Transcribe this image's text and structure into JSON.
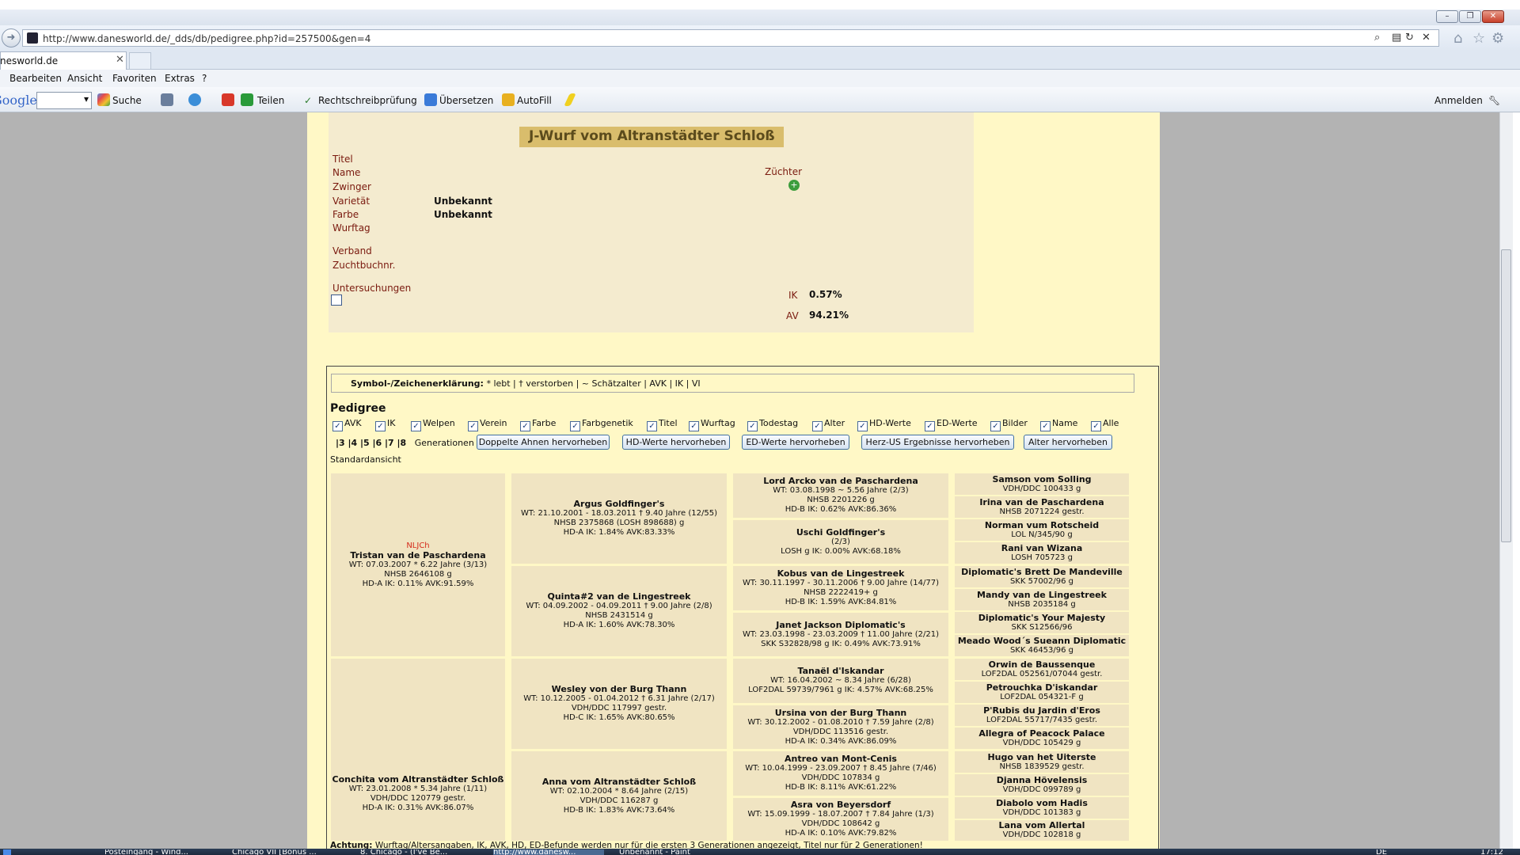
{
  "browser": {
    "url": "http://www.danesworld.de/_dds/db/pedigree.php?id=257500&gen=4",
    "tab_title": "nesworld.de",
    "menu": [
      "Bearbeiten",
      "Ansicht",
      "Favoriten",
      "Extras",
      "?"
    ],
    "toolbar": {
      "google": "Google",
      "suche": "Suche",
      "teilen": "Teilen",
      "spell": "Rechtschreibprüfung",
      "translate": "Übersetzen",
      "autofill": "AutoFill",
      "anmelden": "Anmelden"
    }
  },
  "litter": {
    "heading": "J-Wurf vom Altranstädter Schloß",
    "labels": {
      "titel": "Titel",
      "name": "Name",
      "zwinger": "Zwinger",
      "varietat": "Varietät",
      "farbe": "Farbe",
      "wurftag": "Wurftag",
      "verband": "Verband",
      "zuchtbuch": "Zuchtbuchnr.",
      "untersuchungen": "Untersuchungen",
      "zuchter": "Züchter",
      "ik": "IK",
      "av": "AV"
    },
    "values": {
      "varietat": "Unbekannt",
      "farbe": "Unbekannt",
      "ik": "0.57%",
      "av": "94.21%"
    }
  },
  "pedigree": {
    "legend_label": "Symbol-/Zeichenerklärung:",
    "legend_text": " * lebt | † verstorben | ~ Schätzalter | AVK | IK | VI",
    "title": "Pedigree",
    "checkboxes": [
      "AVK",
      "IK",
      "Welpen",
      "Verein",
      "Farbe",
      "Farbgenetik",
      "Titel",
      "Wurftag",
      "Todestag",
      "Alter",
      "HD-Werte",
      "ED-Werte",
      "Bilder",
      "Name",
      "Alle"
    ],
    "generations": "|3 |4 |5 |6 |7 |8",
    "generations_label": "Generationen",
    "buttons": [
      "Doppelte Ahnen hervorheben",
      "HD-Werte hervorheben",
      "ED-Werte hervorheben",
      "Herz-US Ergebnisse hervorheben",
      "Alter hervorheben"
    ],
    "standard_view": "Standardansicht",
    "note_label": "Achtung:",
    "note_text": " Wurftag/Altersangaben, IK, AVK, HD, ED-Befunde werden nur für die ersten 3 Generationen angezeigt, Titel nur für 2 Generationen!",
    "gen1": [
      {
        "title": "NLJCh",
        "name": "Tristan van de Paschardena",
        "l1": "WT: 07.03.2007 * 6.22 Jahre (3/13)",
        "l2": "NHSB 2646108   g",
        "l3": "HD-A   IK: 0.11%   AVK:91.59%"
      },
      {
        "title": "",
        "name": "Conchita vom Altranstädter Schloß",
        "l1": "WT: 23.01.2008 * 5.34 Jahre (1/11)",
        "l2": "VDH/DDC 120779   gestr.",
        "l3": "HD-A   IK: 0.31%   AVK:86.07%"
      }
    ],
    "gen2": [
      {
        "name": "Argus Goldfinger's",
        "l1": "WT: 21.10.2001 - 18.03.2011 † 9.40 Jahre (12/55)",
        "l2": "NHSB 2375868 (LOSH 898688)   g",
        "l3": "HD-A   IK: 1.84%   AVK:83.33%"
      },
      {
        "name": "Quinta#2 van de Lingestreek",
        "l1": "WT: 04.09.2002 - 04.09.2011 † 9.00 Jahre (2/8)",
        "l2": "NHSB 2431514   g",
        "l3": "HD-A   IK: 1.60%   AVK:78.30%"
      },
      {
        "name": "Wesley von der Burg Thann",
        "l1": "WT: 10.12.2005 - 01.04.2012 † 6.31 Jahre (2/17)",
        "l2": "VDH/DDC 117997   gestr.",
        "l3": "HD-C   IK: 1.65%   AVK:80.65%"
      },
      {
        "name": "Anna vom Altranstädter Schloß",
        "l1": "WT: 02.10.2004 * 8.64 Jahre (2/15)",
        "l2": "VDH/DDC 116287   g",
        "l3": "HD-B   IK: 1.83%   AVK:73.64%"
      }
    ],
    "gen3": [
      {
        "name": "Lord Arcko van de Paschardena",
        "l1": "WT: 03.08.1998 ~ 5.56 Jahre (2/3)",
        "l2": "NHSB 2201226   g",
        "l3": "HD-B   IK: 0.62%   AVK:86.36%"
      },
      {
        "name": "Uschi Goldfinger's",
        "l1": "(2/3)",
        "l2": "",
        "l3": "LOSH   g   IK: 0.00%   AVK:68.18%"
      },
      {
        "name": "Kobus van de Lingestreek",
        "l1": "WT: 30.11.1997 - 30.11.2006 † 9.00 Jahre (14/77)",
        "l2": "NHSB 2222419+   g",
        "l3": "HD-B   IK: 1.59%   AVK:84.81%"
      },
      {
        "name": "Janet Jackson Diplomatic's",
        "l1": "WT: 23.03.1998 - 23.03.2009 † 11.00 Jahre (2/21)",
        "l2": "",
        "l3": "SKK S32828/98   g   IK: 0.49%   AVK:73.91%"
      },
      {
        "name": "Tanaël d'Iskandar",
        "l1": "WT: 16.04.2002 ~ 8.34 Jahre (6/28)",
        "l2": "",
        "l3": "LOF2DAL 59739/7961   g   IK: 4.57%   AVK:68.25%"
      },
      {
        "name": "Ursina von der Burg Thann",
        "l1": "WT: 30.12.2002 - 01.08.2010 † 7.59 Jahre (2/8)",
        "l2": "VDH/DDC 113516   gestr.",
        "l3": "HD-A   IK: 0.34%   AVK:86.09%"
      },
      {
        "name": "Antreo van Mont-Cenis",
        "l1": "WT: 10.04.1999 - 23.09.2007 † 8.45 Jahre (7/46)",
        "l2": "VDH/DDC 107834   g",
        "l3": "HD-B   IK: 8.11%   AVK:61.22%"
      },
      {
        "name": "Asra von Beyersdorf",
        "l1": "WT: 15.09.1999 - 18.07.2007 † 7.84 Jahre (1/3)",
        "l2": "VDH/DDC 108642   g",
        "l3": "HD-A   IK: 0.10%   AVK:79.82%"
      }
    ],
    "gen4": [
      {
        "name": "Samson vom Solling",
        "reg": "VDH/DDC 100433   g"
      },
      {
        "name": "Irina van de Paschardena",
        "reg": "NHSB 2071224   gestr."
      },
      {
        "name": "Norman vum Rotscheid",
        "reg": "LOL N/345/90   g"
      },
      {
        "name": "Rani van Wizana",
        "reg": "LOSH 705723   g"
      },
      {
        "name": "Diplomatic's Brett De Mandeville",
        "reg": "SKK 57002/96   g"
      },
      {
        "name": "Mandy van de Lingestreek",
        "reg": "NHSB 2035184   g"
      },
      {
        "name": "Diplomatic's Your Majesty",
        "reg": "SKK S12566/96"
      },
      {
        "name": "Meado Wood´s Sueann Diplomatic",
        "reg": "SKK 46453/96   g"
      },
      {
        "name": "Orwin de Baussenque",
        "reg": "LOF2DAL 052561/07044   gestr."
      },
      {
        "name": "Petrouchka D'iskandar",
        "reg": "LOF2DAL 054321-F   g"
      },
      {
        "name": "P'Rubis du Jardin d'Eros",
        "reg": "LOF2DAL 55717/7435   gestr."
      },
      {
        "name": "Allegra of Peacock Palace",
        "reg": "VDH/DDC 105429   g"
      },
      {
        "name": "Hugo van het Uiterste",
        "reg": "NHSB 1839529   gestr."
      },
      {
        "name": "Djanna Hövelensis",
        "reg": "VDH/DDC 099789   g"
      },
      {
        "name": "Diabolo vom Hadis",
        "reg": "VDH/DDC 101383   g"
      },
      {
        "name": "Lana vom Allertal",
        "reg": "VDH/DDC 102818   g"
      }
    ]
  },
  "taskbar": {
    "items": [
      "Posteingang - Wind...",
      "Chicago VII [Bonus ...",
      "8. Chicago - (I've Be...",
      "http://www.danesw...",
      "Unbenannt - Paint"
    ],
    "lang": "DE",
    "time": "17:12"
  }
}
